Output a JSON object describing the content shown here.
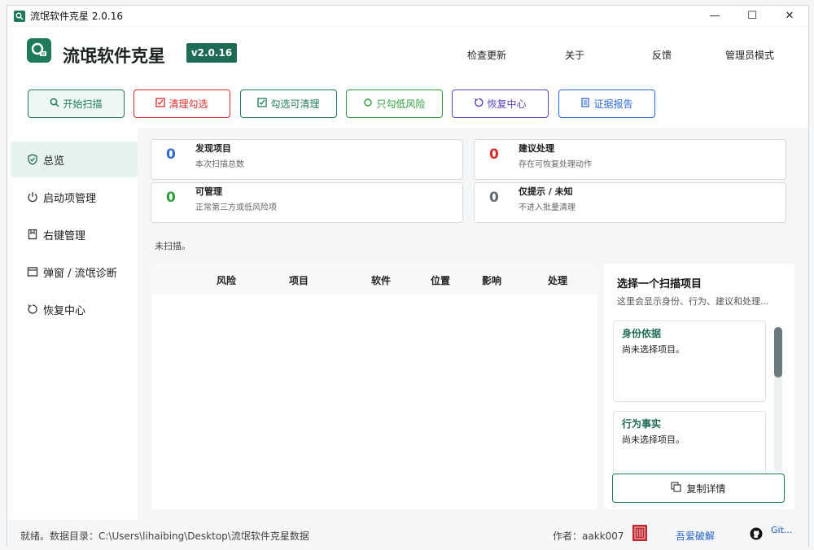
{
  "window": {
    "title": "流氓软件克星 2.0.16",
    "minimize": "—",
    "maximize": "☐",
    "close": "✕"
  },
  "header": {
    "app_name": "流氓软件克星",
    "version": "v2.0.16",
    "nav": [
      "检查更新",
      "关于",
      "反馈",
      "管理员模式"
    ]
  },
  "toolbar": {
    "buttons": [
      {
        "label": "开始扫描",
        "icon": "search-icon",
        "color": "#1f7a5a"
      },
      {
        "label": "清理勾选",
        "icon": "checkbox-icon",
        "color": "#d92b2b"
      },
      {
        "label": "勾选可清理",
        "icon": "checkbox-icon",
        "color": "#1f7a5a"
      },
      {
        "label": "只勾低风险",
        "icon": "circle-icon",
        "color": "#2e9c3c"
      },
      {
        "label": "恢复中心",
        "icon": "restore-icon",
        "color": "#5a3fc0"
      },
      {
        "label": "证据报告",
        "icon": "document-icon",
        "color": "#2f6bd6"
      }
    ]
  },
  "sidebar": {
    "items": [
      {
        "label": "总览",
        "icon": "shield-check-icon"
      },
      {
        "label": "启动项管理",
        "icon": "power-icon"
      },
      {
        "label": "右键管理",
        "icon": "bookmark-icon"
      },
      {
        "label": "弹窗 / 流氓诊断",
        "icon": "window-icon"
      },
      {
        "label": "恢复中心",
        "icon": "restore-icon"
      }
    ]
  },
  "stats": [
    {
      "value": "0",
      "title": "发现项目",
      "sub": "本次扫描总数",
      "color": "#2f6bd6"
    },
    {
      "value": "0",
      "title": "建议处理",
      "sub": "存在可恢复处理动作",
      "color": "#d92b2b"
    },
    {
      "value": "0",
      "title": "可管理",
      "sub": "正常第三方或低风险项",
      "color": "#2e9c3c"
    },
    {
      "value": "0",
      "title": "仅提示 / 未知",
      "sub": "不进入批量清理",
      "color": "#5f6b70"
    }
  ],
  "status": "未扫描。",
  "table": {
    "columns": [
      "风险",
      "项目",
      "软件",
      "位置",
      "影响",
      "处理"
    ]
  },
  "detail": {
    "title": "选择一个扫描项目",
    "subtitle": "这里会显示身份、行为、建议和处理...",
    "sections": [
      {
        "title": "身份依据",
        "text": "尚未选择项目。"
      },
      {
        "title": "行为事实",
        "text": "尚未选择项目。"
      }
    ],
    "copy_label": "复制详情"
  },
  "footer": {
    "status": "就绪。数据目录：C:\\Users\\lihaibing\\Desktop\\流氓软件克星数据",
    "author": "作者：aakk007",
    "link": "吾爱破解",
    "github": "Git..."
  }
}
